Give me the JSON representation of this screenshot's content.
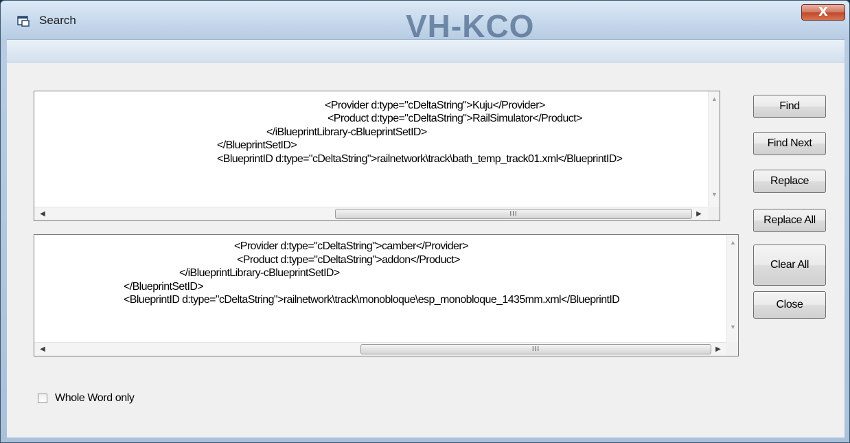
{
  "window": {
    "title": "Search",
    "close_label": "X",
    "background_text": "VH-KCO"
  },
  "find_box": {
    "lines": [
      "<Provider d:type=\"cDeltaString\">Kuju</Provider>",
      "<Product d:type=\"cDeltaString\">RailSimulator</Product>",
      "</iBlueprintLibrary-cBlueprintSetID>",
      "</BlueprintSetID>",
      "<BlueprintID d:type=\"cDeltaString\">railnetwork\\track\\bath_temp_track01.xml</BlueprintID>"
    ],
    "scroll_left": "◀",
    "scroll_right": "▶",
    "scroll_up": "▲",
    "scroll_down": "▼",
    "grip": "III"
  },
  "replace_box": {
    "lines": [
      "<Provider d:type=\"cDeltaString\">camber</Provider>",
      "<Product d:type=\"cDeltaString\">addon</Product>",
      "</iBlueprintLibrary-cBlueprintSetID>",
      "</BlueprintSetID>",
      "<BlueprintID d:type=\"cDeltaString\">railnetwork\\track\\monobloque\\esp_monobloque_1435mm.xml</BlueprintID"
    ],
    "scroll_left": "◀",
    "scroll_right": "▶",
    "scroll_up": "▲",
    "scroll_down": "▼",
    "grip": "III"
  },
  "buttons": {
    "find": "Find",
    "find_next": "Find Next",
    "replace": "Replace",
    "replace_all": "Replace All",
    "clear_all": "Clear All",
    "close": "Close"
  },
  "options": {
    "whole_word_label": "Whole Word only",
    "whole_word_checked": false
  },
  "icons": {
    "title_icon": "window-app-icon",
    "close_icon": "close-icon"
  }
}
